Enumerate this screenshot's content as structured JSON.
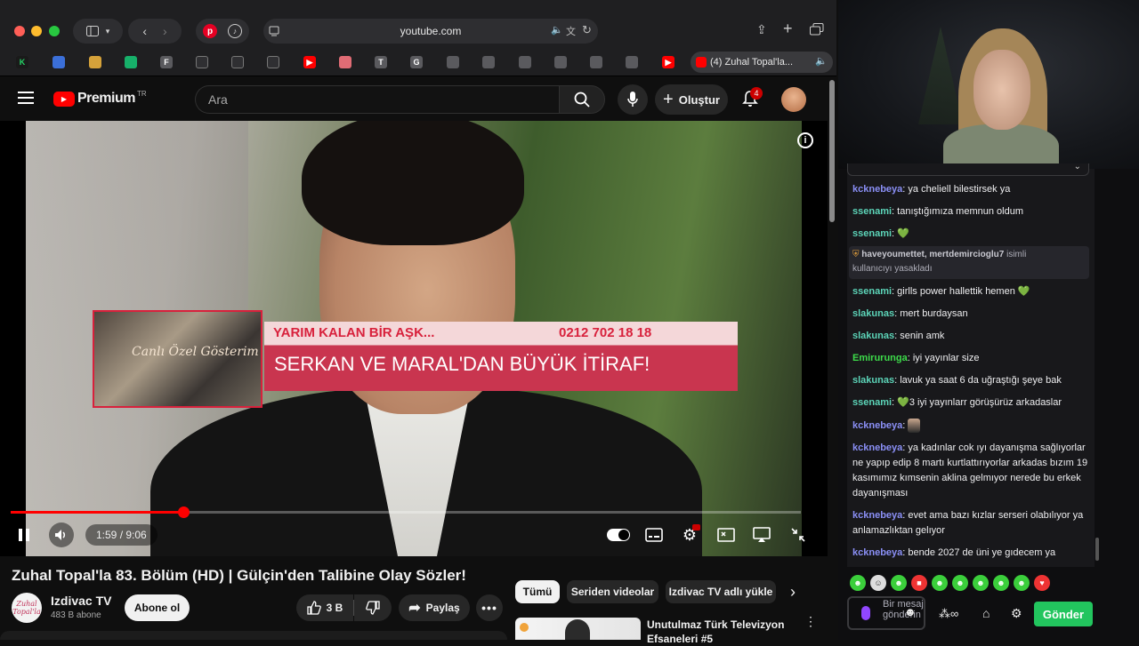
{
  "browser": {
    "url": "youtube.com",
    "tab_title": "(4) Zuhal Topal'la...",
    "bookmarks": [
      "K",
      "",
      "",
      "",
      "F",
      "",
      "",
      "",
      "",
      "",
      "T",
      "G",
      "",
      "",
      "",
      "",
      "",
      "",
      ""
    ]
  },
  "header": {
    "brand": "Premium",
    "brand_suffix": "TR",
    "search_placeholder": "Ara",
    "create_label": "Oluştur",
    "notification_count": "4"
  },
  "video": {
    "overlay_title": "YARIM KALAN BİR AŞK...",
    "overlay_phone": "0212 702 18 18",
    "overlay_main": "SERKAN VE MARAL'DAN BÜYÜK İTİRAF!",
    "inset_text": "Canlı Özel Gösterim",
    "current_time": "1:59",
    "duration": "9:06",
    "time_display": "1:59 / 9:06",
    "progress_fraction": 0.218
  },
  "below": {
    "title": "Zuhal Topal'la 83. Bölüm (HD) | Gülçin'den Talibine Olay Sözler!",
    "channel_name": "Izdivac TV",
    "channel_subs": "483 B abone",
    "channel_avatar_text": "Zuhal Topal'la",
    "subscribe_label": "Abone ol",
    "likes": "3 B",
    "share_label": "Paylaş",
    "chips": [
      "Tümü",
      "Seriden videolar",
      "Izdivac TV adlı yükle"
    ],
    "rec_title": "Unutulmaz Türk Televizyon Efsaneleri #5"
  },
  "chat": {
    "top_partial": "kcknebeya: ya cheliell biliestirsek ya",
    "messages": [
      {
        "user": "kcknebeya",
        "color": "#8a8ff5",
        "text": "ya cheliell bilestirsek ya"
      },
      {
        "user": "ssenami",
        "color": "#5cd4b8",
        "text": "tanıştığımıza memnun oldum"
      },
      {
        "user": "ssenami",
        "color": "#5cd4b8",
        "text": "💚"
      },
      {
        "user": "ssenami",
        "color": "#5cd4b8",
        "text": "girlls power hallettik hemen 💚"
      },
      {
        "user": "slakunas",
        "color": "#5cd4b8",
        "text": "mert burdaysan"
      },
      {
        "user": "slakunas",
        "color": "#5cd4b8",
        "text": "senin amk"
      },
      {
        "user": "Emirurunga",
        "color": "#3ddc4a",
        "text": "iyi yayınlar size"
      },
      {
        "user": "slakunas",
        "color": "#5cd4b8",
        "text": "lavuk ya saat 6 da uğraştığı şeye bak"
      },
      {
        "user": "ssenami",
        "color": "#5cd4b8",
        "text": "💚3 iyi yayınlarr görüşürüz arkadaslar"
      },
      {
        "user": "kcknebeya",
        "color": "#8a8ff5",
        "text": ""
      },
      {
        "user": "kcknebeya",
        "color": "#8a8ff5",
        "text": "ya kadınlar cok ıyı dayanışma sağlıyorlar ne yapıp edip 8 martı kurtlattırıyorlar arkadas bızım 19 kasımımız kımsenin aklina gelmıyor nerede bu erkek dayanışması"
      },
      {
        "user": "kcknebeya",
        "color": "#8a8ff5",
        "text": "evet ama bazı kızlar serseri olabılıyor ya anlamazlıktan gelıyor"
      },
      {
        "user": "kcknebeya",
        "color": "#8a8ff5",
        "text": "bende 2027 de üni ye gıdecem ya"
      }
    ],
    "system_users": "haveyoumettet, mertdemircioglu7",
    "system_text_1": "isimli",
    "system_text_2": "kullanıcıyı yasakladı",
    "input_placeholder": "Bir mesaj gönderin",
    "send_label": "Gönder"
  },
  "colors": {
    "yt_red": "#ff0000",
    "send_green": "#22c55e",
    "overlay_red": "#c9354f"
  }
}
